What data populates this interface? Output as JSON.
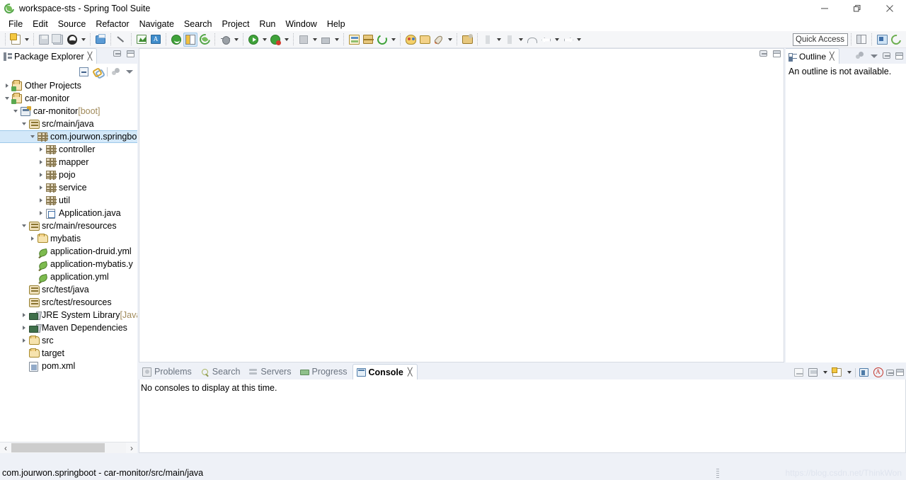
{
  "window": {
    "title": "workspace-sts - Spring Tool Suite",
    "app_icon": "spring-logo-icon",
    "minimize_label": "—",
    "maximize_label": "❐",
    "close_label": "✕"
  },
  "menubar": {
    "items": [
      {
        "label": "File"
      },
      {
        "label": "Edit"
      },
      {
        "label": "Source"
      },
      {
        "label": "Refactor"
      },
      {
        "label": "Navigate"
      },
      {
        "label": "Search"
      },
      {
        "label": "Project"
      },
      {
        "label": "Run"
      },
      {
        "label": "Window"
      },
      {
        "label": "Help"
      }
    ]
  },
  "toolbar": {
    "quick_access_placeholder": "Quick Access",
    "icons": [
      "new-wizard-icon",
      "save-icon",
      "save-all-icon",
      "toggle-user-icon",
      "print-icon",
      "quick-fix-icon",
      "open-resource-icon",
      "annotations-icon",
      "spring-boot-dashboard-icon",
      "open-perspective-icon",
      "spring-icon",
      "debug-icon",
      "run-icon",
      "run-with-error-icon",
      "terminate-icon",
      "build-icon",
      "open-type-icon",
      "new-package-icon",
      "refresh-icon",
      "color-palette-icon",
      "folder-icon",
      "rocket-icon",
      "external-tools-icon",
      "skip-breakpoints-icon",
      "next-annotation-icon",
      "back-icon",
      "forward-icon"
    ],
    "right_icons": [
      "open-perspective-icon",
      "java-ee-perspective-icon",
      "spring-perspective-icon"
    ]
  },
  "package_explorer": {
    "tab_label": "Package Explorer",
    "tab_icon": "package-explorer-icon",
    "close_icon": "╳",
    "view_tools": [
      "collapse-all-icon",
      "link-with-editor-icon",
      "focus-icon",
      "view-menu-icon"
    ],
    "tree": [
      {
        "label": "Other Projects",
        "icon": "project-icon",
        "indent": 0,
        "state": "collapsed",
        "selected": false
      },
      {
        "label": "car-monitor",
        "icon": "project-icon",
        "indent": 0,
        "state": "expanded",
        "selected": false
      },
      {
        "label": "car-monitor",
        "suffix": " [boot]",
        "icon": "boot-project-icon",
        "indent": 1,
        "state": "expanded",
        "selected": false
      },
      {
        "label": "src/main/java",
        "icon": "source-folder-icon",
        "indent": 2,
        "state": "expanded",
        "selected": false
      },
      {
        "label": "com.jourwon.springbo",
        "icon": "package-icon",
        "indent": 3,
        "state": "expanded",
        "selected": true
      },
      {
        "label": "controller",
        "icon": "package-icon",
        "indent": 4,
        "state": "collapsed",
        "selected": false
      },
      {
        "label": "mapper",
        "icon": "package-icon",
        "indent": 4,
        "state": "collapsed",
        "selected": false
      },
      {
        "label": "pojo",
        "icon": "package-icon",
        "indent": 4,
        "state": "collapsed",
        "selected": false
      },
      {
        "label": "service",
        "icon": "package-icon",
        "indent": 4,
        "state": "collapsed",
        "selected": false
      },
      {
        "label": "util",
        "icon": "package-icon",
        "indent": 4,
        "state": "collapsed",
        "selected": false
      },
      {
        "label": "Application.java",
        "icon": "java-file-icon",
        "indent": 4,
        "state": "collapsed",
        "selected": false
      },
      {
        "label": "src/main/resources",
        "icon": "source-folder-icon",
        "indent": 2,
        "state": "expanded",
        "selected": false
      },
      {
        "label": "mybatis",
        "icon": "folder-icon",
        "indent": 3,
        "state": "collapsed",
        "selected": false
      },
      {
        "label": "application-druid.yml",
        "icon": "yaml-file-icon",
        "indent": 3,
        "state": "none",
        "selected": false
      },
      {
        "label": "application-mybatis.y",
        "icon": "yaml-file-icon",
        "indent": 3,
        "state": "none",
        "selected": false
      },
      {
        "label": "application.yml",
        "icon": "yaml-file-icon",
        "indent": 3,
        "state": "none",
        "selected": false
      },
      {
        "label": "src/test/java",
        "icon": "source-folder-icon",
        "indent": 2,
        "state": "none",
        "selected": false
      },
      {
        "label": "src/test/resources",
        "icon": "source-folder-icon",
        "indent": 2,
        "state": "none",
        "selected": false
      },
      {
        "label": "JRE System Library",
        "suffix": " [Java",
        "icon": "library-icon",
        "indent": 2,
        "state": "collapsed",
        "selected": false
      },
      {
        "label": "Maven Dependencies",
        "icon": "library-icon",
        "indent": 2,
        "state": "collapsed",
        "selected": false
      },
      {
        "label": "src",
        "icon": "folder-icon",
        "indent": 2,
        "state": "collapsed",
        "selected": false
      },
      {
        "label": "target",
        "icon": "folder-icon",
        "indent": 2,
        "state": "none",
        "selected": false
      },
      {
        "label": "pom.xml",
        "icon": "xml-file-icon",
        "indent": 2,
        "state": "none",
        "selected": false
      }
    ],
    "scroll_left_label": "‹",
    "scroll_right_label": "›"
  },
  "outline": {
    "tab_label": "Outline",
    "tab_icon": "outline-icon",
    "close_icon": "╳",
    "message": "An outline is not available."
  },
  "bottom_panel": {
    "tabs": [
      {
        "label": "Problems",
        "icon": "problems-icon",
        "active": false
      },
      {
        "label": "Search",
        "icon": "search-icon",
        "active": false
      },
      {
        "label": "Servers",
        "icon": "servers-icon",
        "active": false
      },
      {
        "label": "Progress",
        "icon": "progress-icon",
        "active": false
      },
      {
        "label": "Console",
        "icon": "console-icon",
        "active": true
      }
    ],
    "close_icon": "╳",
    "message": "No consoles to display at this time.",
    "tools": [
      "clear-console-icon",
      "scroll-lock-icon",
      "display-selected-console-icon",
      "open-console-icon",
      "pin-console-icon",
      "word-wrap-icon"
    ]
  },
  "statusbar": {
    "text": "com.jourwon.springboot - car-monitor/src/main/java",
    "watermark": "https://blog.csdn.net/ThinkWon"
  }
}
